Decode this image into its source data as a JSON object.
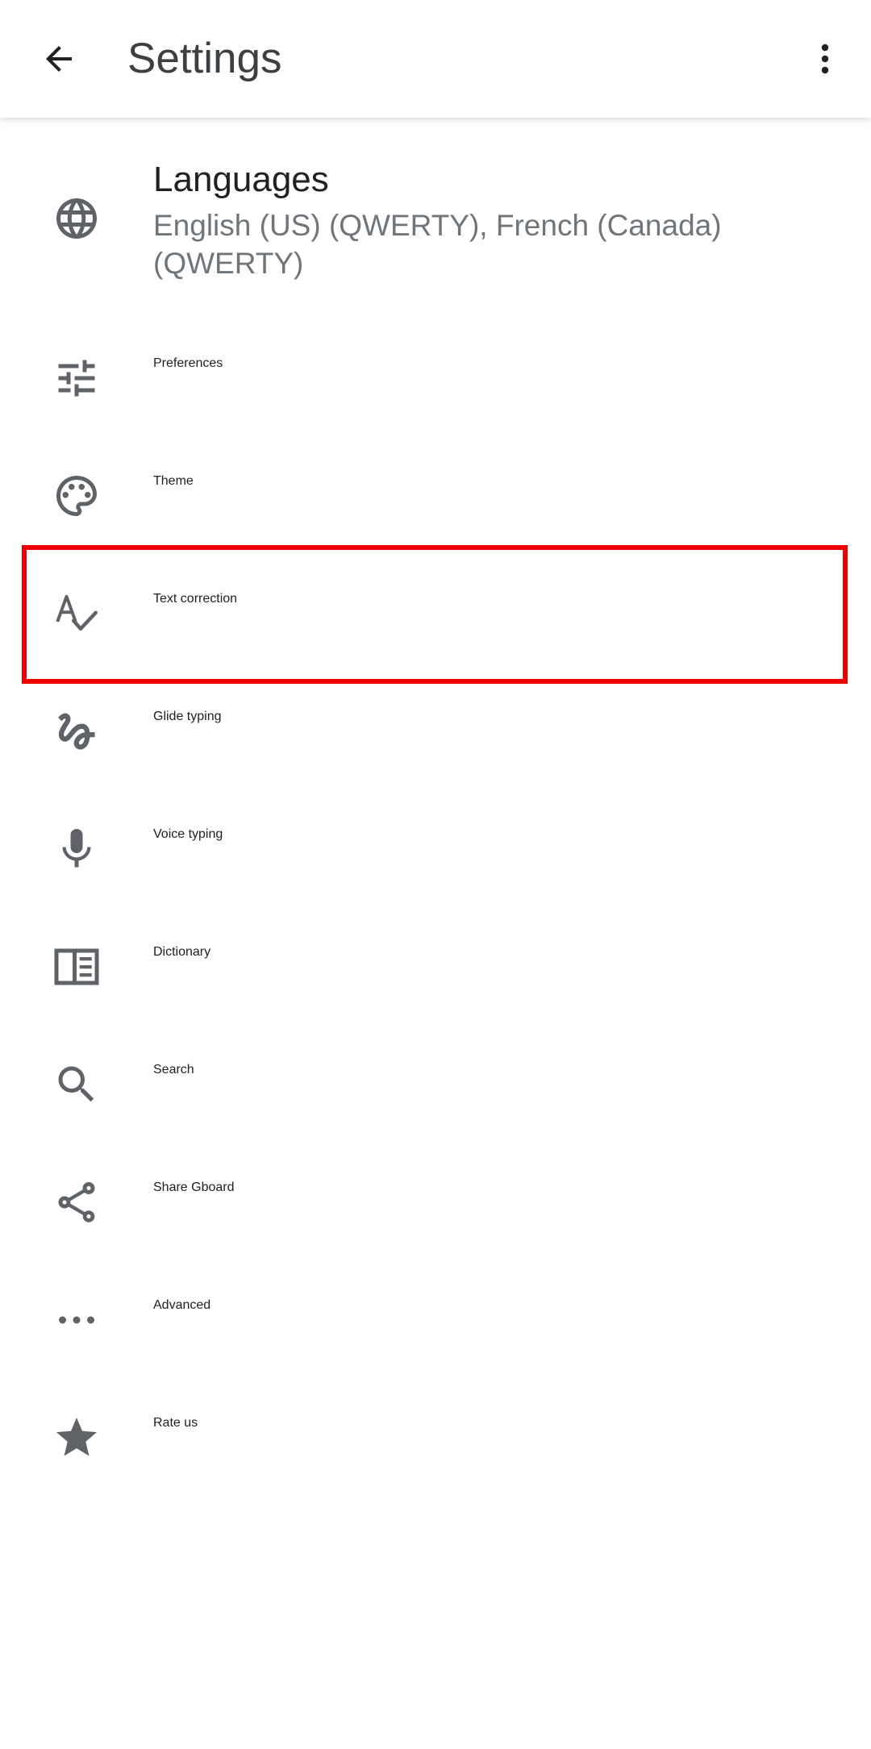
{
  "app_bar": {
    "title": "Settings",
    "back_icon": "arrow-back-icon",
    "overflow_icon": "more-vert-icon"
  },
  "settings": [
    {
      "title": "Languages",
      "summary": "English (US) (QWERTY), French (Canada) (QWERTY)",
      "icon": "globe-icon"
    },
    {
      "title": "Preferences",
      "icon": "tune-sliders-icon"
    },
    {
      "title": "Theme",
      "icon": "palette-icon"
    },
    {
      "title": "Text correction",
      "icon": "spellcheck-icon"
    },
    {
      "title": "Glide typing",
      "icon": "gesture-icon"
    },
    {
      "title": "Voice typing",
      "icon": "microphone-icon"
    },
    {
      "title": "Dictionary",
      "icon": "dictionary-book-icon"
    },
    {
      "title": "Search",
      "icon": "search-icon"
    },
    {
      "title": "Share Gboard",
      "icon": "share-icon"
    },
    {
      "title": "Advanced",
      "icon": "more-horiz-icon"
    },
    {
      "title": "Rate us",
      "icon": "star-icon"
    }
  ],
  "highlighted_item": "Text correction",
  "colors": {
    "icon": "#5f6368",
    "title_text": "#202124",
    "summary_text": "#70757a",
    "highlight_border": "#ee0000",
    "background": "#ffffff"
  }
}
